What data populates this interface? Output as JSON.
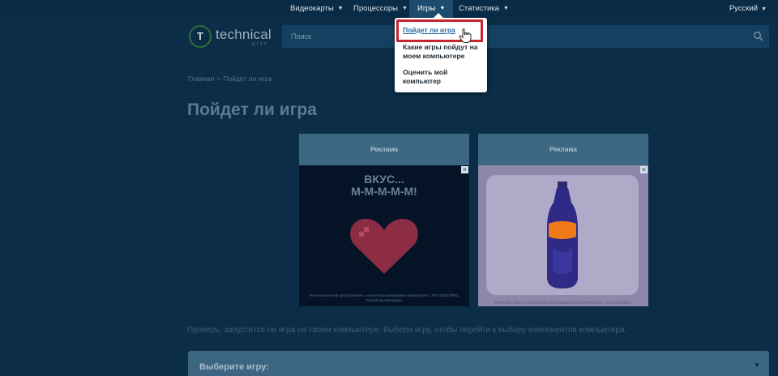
{
  "nav": {
    "items": [
      {
        "label": "Видеокарты"
      },
      {
        "label": "Процессоры"
      },
      {
        "label": "Игры"
      },
      {
        "label": "Статистика"
      }
    ],
    "language": "Русский"
  },
  "logo": {
    "name": "technical",
    "sub": "CITY"
  },
  "search": {
    "placeholder": "Поиск"
  },
  "breadcrumb": {
    "home": "Главная",
    "separator": ">",
    "current": "Пойдет ли игра"
  },
  "page": {
    "title": "Пойдет ли игра"
  },
  "ads": [
    {
      "label": "Реклама",
      "headline": "ВКУС...\nМ-М-М-М-М!",
      "fine_print": "Уполномоченный представитель «Кока-Кола Бевериджиз Белоруссия», УНП 100378962, Республика Беларусь"
    },
    {
      "label": "Реклама",
      "fine_print": "РЕКЛАМА  ИООО «КОКА-КОЛА БЕВЕРИДЖИЗ БЕЛОРУССИЯ», УНП 100378962"
    }
  ],
  "description": "Проверь, запустится ли игра на твоем компьютере. Выбери игру, чтобы перейти к выбору компонентов компьютера.",
  "select": {
    "label": "Выберите игру:"
  },
  "dropdown": {
    "items": [
      {
        "label": "Пойдет ли игра"
      },
      {
        "label": "Какие игры пойдут на моем компьютере"
      },
      {
        "label": "Оценить мой компьютер"
      }
    ]
  },
  "colors": {
    "accent": "#2b6aa8",
    "highlight": "#c6252f",
    "background": "#0b2d48"
  }
}
